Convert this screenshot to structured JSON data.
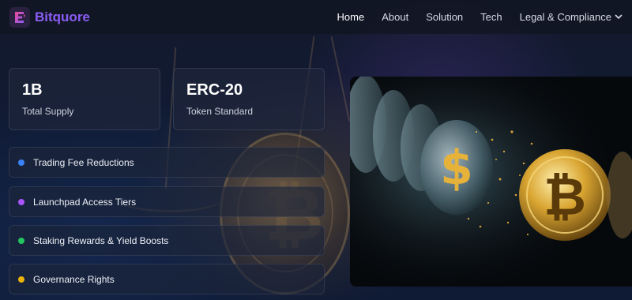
{
  "header": {
    "brand": "Bitquore",
    "nav": [
      {
        "label": "Home",
        "active": true
      },
      {
        "label": "About"
      },
      {
        "label": "Solution"
      },
      {
        "label": "Tech"
      },
      {
        "label": "Legal & Compliance",
        "dropdown": true
      }
    ]
  },
  "stats": [
    {
      "value": "1B",
      "label": "Total Supply"
    },
    {
      "value": "ERC-20",
      "label": "Token Standard"
    }
  ],
  "features": [
    {
      "label": "Trading Fee Reductions",
      "color": "#3b82f6"
    },
    {
      "label": "Launchpad Access Tiers",
      "color": "#a855f7"
    },
    {
      "label": "Staking Rewards & Yield Boosts",
      "color": "#22c55e"
    },
    {
      "label": "Governance Rights",
      "color": "#eab308"
    }
  ],
  "colors": {
    "brand": "#8b5cf6",
    "background": "#0d1426"
  },
  "hero": {
    "icons": [
      "dollar-coin-icon",
      "bitcoin-coin-icon"
    ]
  }
}
